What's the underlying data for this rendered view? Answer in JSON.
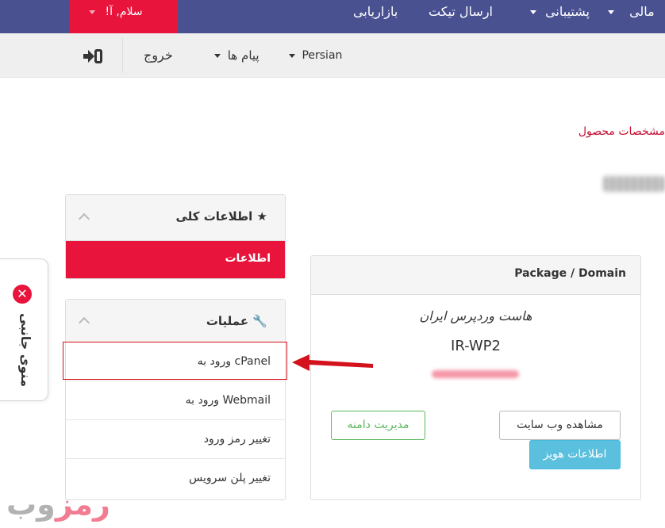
{
  "topnav": {
    "greeting": "!سلام, آ",
    "marketing": "بازاریابی",
    "send_ticket": "ارسال تیکت",
    "support": "پشتیبانی",
    "finance": "مالی"
  },
  "subnav": {
    "logout": "خروج",
    "messages": "پیام ها",
    "language": "Persian"
  },
  "breadcrumb_link": "مشخصات محصول",
  "side_tab": {
    "label": "منوی جانبی"
  },
  "info_panel": {
    "title": "اطلاعات کلی",
    "active_item": "اطلاعات"
  },
  "ops_panel": {
    "title": "عملیات",
    "items": [
      "ورود به cPanel",
      "ورود به Webmail",
      "تغییر رمز ورود",
      "تغییر پلن سرویس"
    ]
  },
  "product_panel": {
    "title": "Package / Domain",
    "product_name": "هاست وردپرس ایران",
    "product_code": "IR-WP2",
    "buttons": {
      "manage_domain": "مدیریت دامنه",
      "view_site": "مشاهده وب سایت",
      "whois": "اطلاعات هویز"
    }
  },
  "watermark": {
    "red_part": "رمز",
    "gray_part": "وب"
  },
  "colors": {
    "navbar": "#4a5191",
    "accent_red": "#e8143c",
    "success": "#5cb85c",
    "info": "#5bc0de"
  }
}
